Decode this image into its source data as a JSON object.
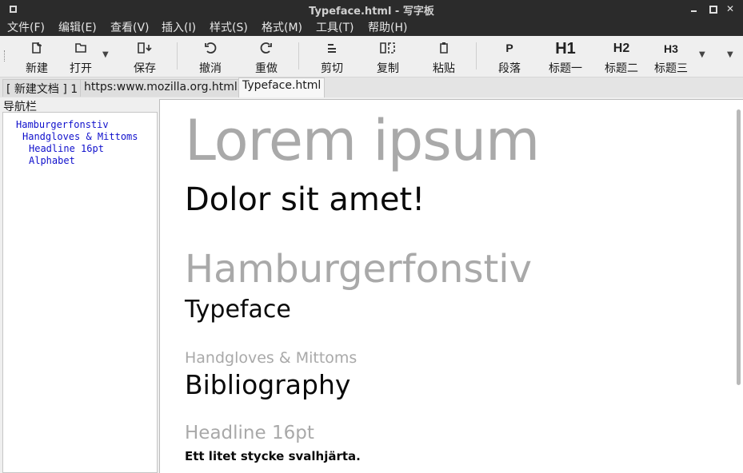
{
  "window": {
    "title": "Typeface.html - 写字板",
    "controls": {
      "minimize": "",
      "maximize": "",
      "close": "✕"
    }
  },
  "menu": [
    "文件(F)",
    "编辑(E)",
    "查看(V)",
    "插入(I)",
    "样式(S)",
    "格式(M)",
    "工具(T)",
    "帮助(H)"
  ],
  "toolbar": {
    "new": "新建",
    "open": "打开",
    "save": "保存",
    "undo": "撤消",
    "redo": "重做",
    "cut": "剪切",
    "copy": "复制",
    "paste": "粘贴",
    "paragraph_icon": "P",
    "paragraph": "段落",
    "h1_icon": "H1",
    "h1": "标题一",
    "h2_icon": "H2",
    "h2": "标题二",
    "h3_icon": "H3",
    "h3": "标题三"
  },
  "tabs": [
    "[ 新建文档 ] 1",
    "https:www.mozilla.org.html",
    "Typeface.html"
  ],
  "navigation": {
    "title": "导航栏",
    "items": [
      "Hamburgerfonstiv",
      "Handgloves & Mittoms",
      "Headline 16pt",
      "Alphabet"
    ]
  },
  "document": {
    "line1": "Lorem ipsum",
    "line2": "Dolor sit amet!",
    "line3": "Hamburgerfonstiv",
    "line4": "Typeface",
    "line5": "Handgloves & Mittoms",
    "line6": "Bibliography",
    "line7": "Headline 16pt",
    "line8": "Ett litet stycke svalhjärta."
  },
  "colors": {
    "titlebar": "#2b2b2b",
    "heading_gray": "#a9a9a9",
    "nav_link": "#1010cc"
  }
}
